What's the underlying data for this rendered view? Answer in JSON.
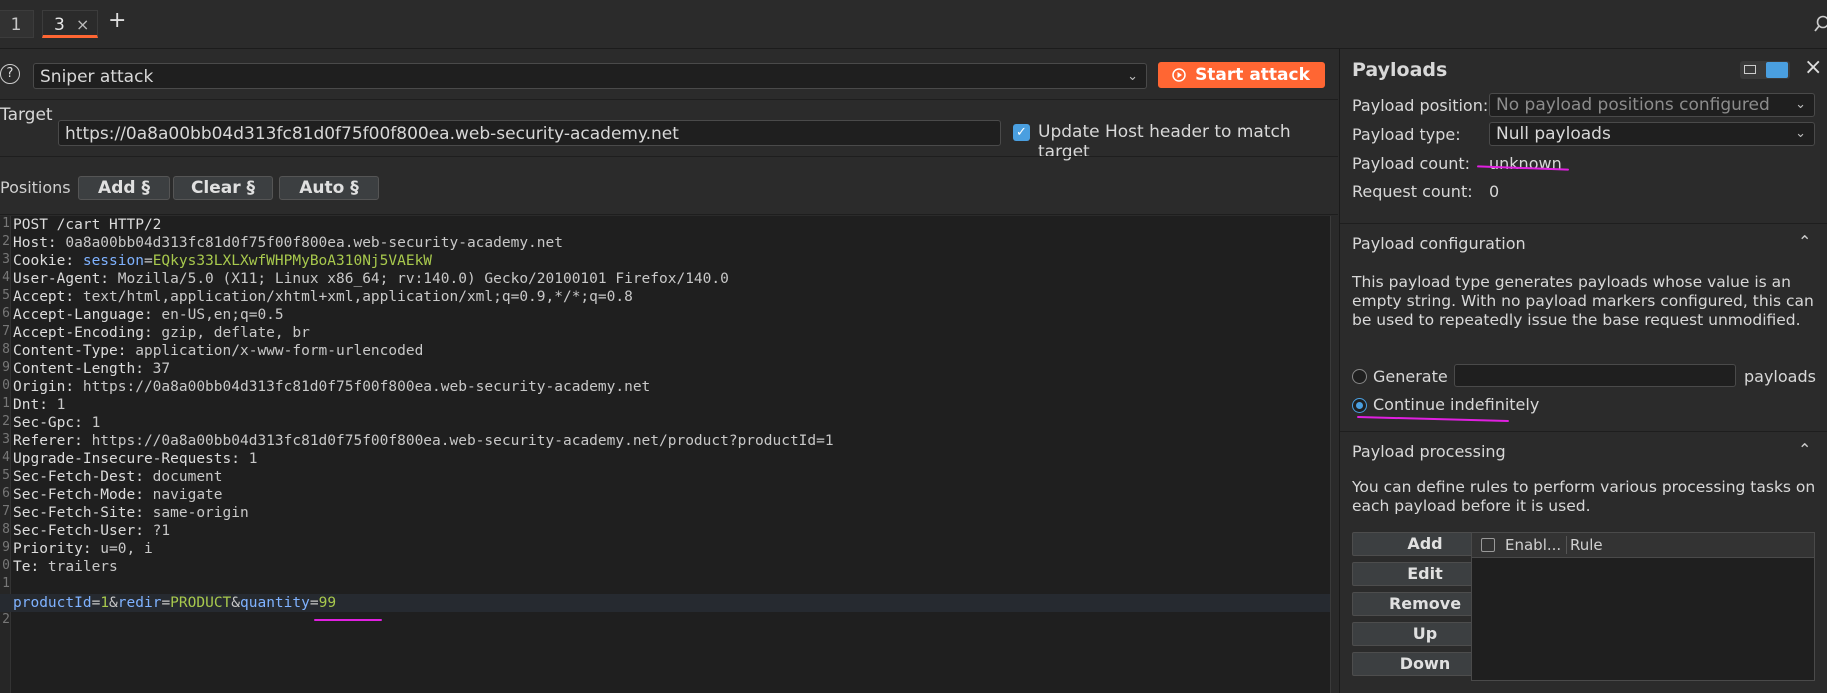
{
  "tabs": [
    {
      "label": "1"
    },
    {
      "label": "3",
      "close": "×"
    }
  ],
  "new_tab_label": "+",
  "attack": {
    "help_label": "?",
    "type_value": "Sniper attack",
    "start_label": "Start attack"
  },
  "target": {
    "label": "Target",
    "url": "https://0a8a00bb04d313fc81d0f75f00f800ea.web-security-academy.net",
    "update_host_label": "Update Host header to match target"
  },
  "positions": {
    "label": "Positions",
    "add_label": "Add §",
    "clear_label": "Clear §",
    "auto_label": "Auto §"
  },
  "request": {
    "gutter": [
      "1",
      "2",
      "3",
      "4",
      "5",
      "6",
      "7",
      "8",
      "9",
      "0",
      "1",
      "2",
      "3",
      "4",
      "5",
      "6",
      "7",
      "8",
      "9",
      "0",
      "1",
      "",
      "2"
    ],
    "lines": [
      {
        "k": "POST /cart HTTP/2",
        "v": ""
      },
      {
        "k": "Host:",
        "v": " 0a8a00bb04d313fc81d0f75f00f800ea.web-security-academy.net"
      },
      {
        "k": "Cookie:",
        "v": ""
      },
      {
        "k": "User-Agent:",
        "v": " Mozilla/5.0 (X11; Linux x86_64; rv:140.0) Gecko/20100101 Firefox/140.0"
      },
      {
        "k": "Accept:",
        "v": " text/html,application/xhtml+xml,application/xml;q=0.9,*/*;q=0.8"
      },
      {
        "k": "Accept-Language:",
        "v": " en-US,en;q=0.5"
      },
      {
        "k": "Accept-Encoding:",
        "v": " gzip, deflate, br"
      },
      {
        "k": "Content-Type:",
        "v": " application/x-www-form-urlencoded"
      },
      {
        "k": "Content-Length:",
        "v": " 37"
      },
      {
        "k": "Origin:",
        "v": " https://0a8a00bb04d313fc81d0f75f00f800ea.web-security-academy.net"
      },
      {
        "k": "Dnt:",
        "v": " 1"
      },
      {
        "k": "Sec-Gpc:",
        "v": " 1"
      },
      {
        "k": "Referer:",
        "v": " https://0a8a00bb04d313fc81d0f75f00f800ea.web-security-academy.net/product?productId=1"
      },
      {
        "k": "Upgrade-Insecure-Requests:",
        "v": " 1"
      },
      {
        "k": "Sec-Fetch-Dest:",
        "v": " document"
      },
      {
        "k": "Sec-Fetch-Mode:",
        "v": " navigate"
      },
      {
        "k": "Sec-Fetch-Site:",
        "v": " same-origin"
      },
      {
        "k": "Sec-Fetch-User:",
        "v": " ?1"
      },
      {
        "k": "Priority:",
        "v": " u=0, i"
      },
      {
        "k": "Te:",
        "v": " trailers"
      }
    ],
    "cookie_name": " session",
    "cookie_eq": "=",
    "cookie_value": "EQkys33LXLXwfWHPMyBoA310Nj5VAEkW",
    "body": {
      "p1": "productId",
      "e1": "=",
      "v1": "1",
      "a1": "&",
      "p2": "redir",
      "e2": "=",
      "v2": "PRODUCT",
      "a2": "&",
      "p3": "quantity",
      "e3": "=",
      "v3": "99"
    }
  },
  "payloads": {
    "title": "Payloads",
    "position_label": "Payload position:",
    "position_value": "No payload positions configured",
    "type_label": "Payload type:",
    "type_value": "Null payloads",
    "count_label": "Payload count:",
    "count_value": "unknown",
    "request_count_label": "Request count:",
    "request_count_value": "0",
    "config_title": "Payload configuration",
    "config_desc": "This payload type generates payloads whose value is an empty string. With no payload markers configured, this can be used to repeatedly issue the base request unmodified.",
    "generate_label": "Generate",
    "generate_suffix": "payloads",
    "continue_label": "Continue indefinitely",
    "processing_title": "Payload processing",
    "processing_desc": "You can define rules to perform various processing tasks on each payload before it is used.",
    "buttons": [
      "Add",
      "Edit",
      "Remove",
      "Up",
      "Down"
    ],
    "table_cols": [
      "Enabl...",
      "Rule"
    ]
  },
  "colors": {
    "accent": "#ff6633",
    "check": "#4a9fe0",
    "annotation": "#e020e0"
  }
}
